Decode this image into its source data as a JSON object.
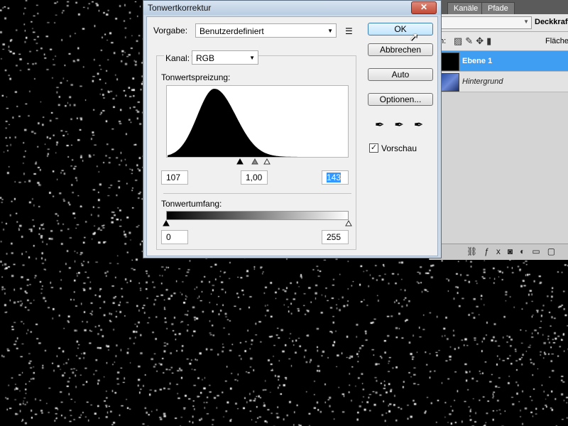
{
  "colors": {
    "canvas_bg": "#000000",
    "speckle": "#ffffff",
    "active_layer": "#3f9ef2",
    "selection_highlight": "#3399ff"
  },
  "layers_panel": {
    "tabs": [
      "Kanäle",
      "Pfade"
    ],
    "opacity_label": "Deckkraft:",
    "lock_label": "n:",
    "fill_label": "Fläche:",
    "layers": [
      {
        "name": "Ebene 1",
        "active": true
      },
      {
        "name": "Hintergrund",
        "active": false
      }
    ],
    "footer_icons": [
      "link-icon",
      "fx-icon",
      "mask-icon",
      "adjustment-icon",
      "folder-icon",
      "new-layer-icon"
    ]
  },
  "dialog": {
    "title": "Tonwertkorrektur",
    "close_label": "✕",
    "preset": {
      "label": "Vorgabe:",
      "value": "Benutzerdefiniert"
    },
    "channel": {
      "label": "Kanal:",
      "value": "RGB"
    },
    "input_levels": {
      "label": "Tonwertspreizung:",
      "black": "107",
      "gamma": "1,00",
      "white": "143"
    },
    "output_levels": {
      "label": "Tonwertumfang:",
      "black": "0",
      "white": "255"
    },
    "buttons": {
      "ok": "OK",
      "cancel": "Abbrechen",
      "auto": "Auto",
      "options": "Optionen..."
    },
    "preview": {
      "label": "Vorschau",
      "checked": true
    }
  }
}
